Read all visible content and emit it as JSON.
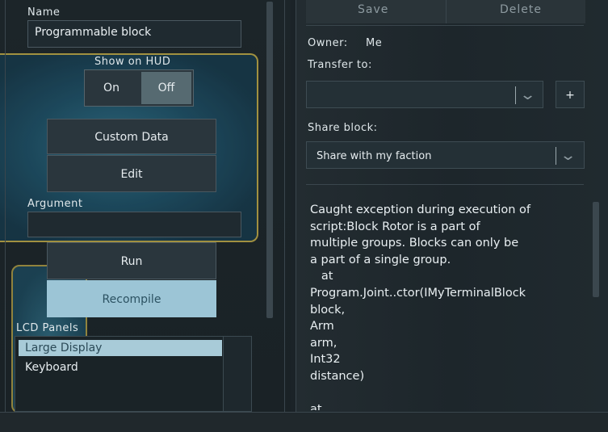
{
  "left": {
    "name_label": "Name",
    "name_value": "Programmable block",
    "hud_label": "Show on HUD",
    "hud_on": "On",
    "hud_off": "Off",
    "custom_data_label": "Custom Data",
    "edit_label": "Edit",
    "argument_label": "Argument",
    "argument_value": "",
    "run_label": "Run",
    "recompile_label": "Recompile",
    "lcd_label": "LCD Panels",
    "lcd_items": [
      "Large Display",
      "Keyboard"
    ]
  },
  "right": {
    "save_label": "Save",
    "delete_label": "Delete",
    "owner_label": "Owner:",
    "owner_value": "Me",
    "transfer_label": "Transfer to:",
    "transfer_value": "",
    "plus_label": "+",
    "share_label": "Share block:",
    "share_value": "Share with my faction",
    "output_text": "Caught exception during execution of\nscript:Block Rotor is a part of\nmultiple groups. Blocks can only be\na part of a single group.\n   at\nProgram.Joint..ctor(IMyTerminalBlock\nblock,\nArm\narm,\nInt32\ndistance)\n\nat"
  }
}
